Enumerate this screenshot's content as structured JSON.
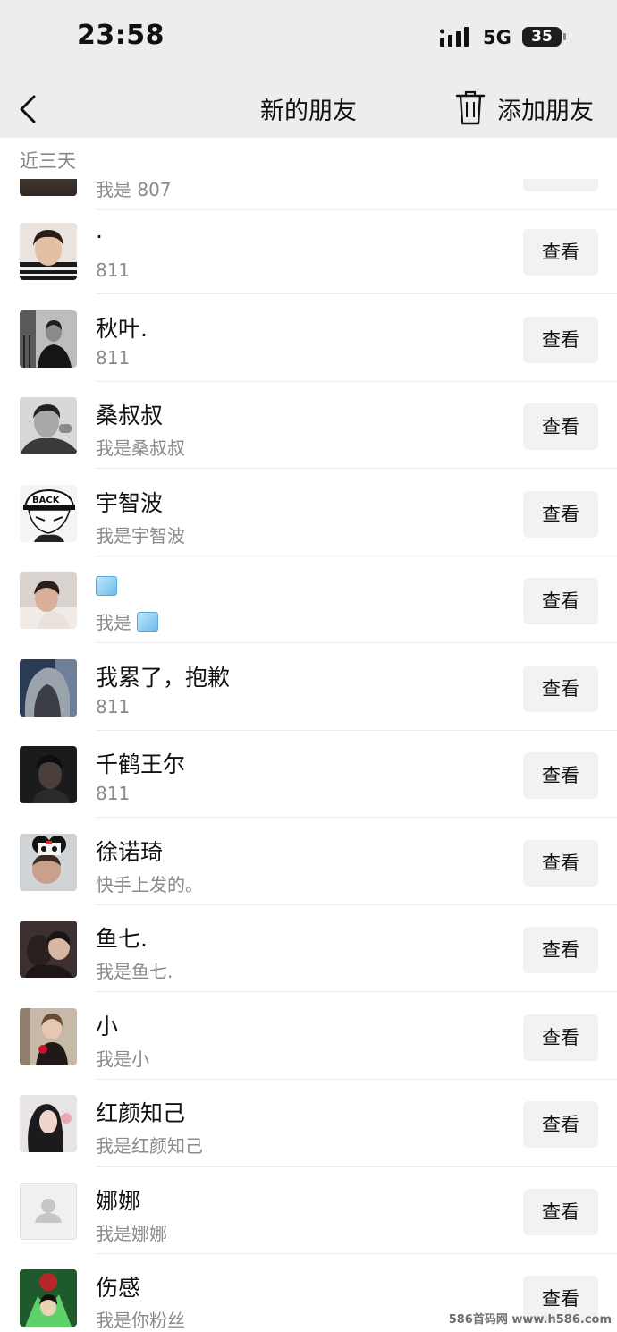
{
  "status_bar": {
    "time": "23:58",
    "network": "5G",
    "battery": "35"
  },
  "nav": {
    "title": "新的朋友",
    "add_friend_label": "添加朋友"
  },
  "section": {
    "label": "近三天"
  },
  "partial_row": {
    "message": "我是 807"
  },
  "view_label": "查看",
  "rows": [
    {
      "name": "·",
      "message": "811",
      "avatar": "portrait-boy-smiling",
      "has_ice_emoji": false
    },
    {
      "name": "秋叶.",
      "message": "811",
      "avatar": "portrait-man-suit-bw",
      "has_ice_emoji": false
    },
    {
      "name": "桑叔叔",
      "message": "我是桑叔叔",
      "avatar": "portrait-man-bw",
      "has_ice_emoji": false
    },
    {
      "name": "宇智波",
      "message": "我是宇智波",
      "avatar": "anime-cap-boy",
      "has_ice_emoji": false
    },
    {
      "name": "",
      "message": "我是",
      "avatar": "portrait-boy-lying",
      "has_ice_emoji": true
    },
    {
      "name": "我累了，抱歉",
      "message": "811",
      "avatar": "hooded-figure",
      "has_ice_emoji": false
    },
    {
      "name": "千鹤王尔",
      "message": "811",
      "avatar": "portrait-dark",
      "has_ice_emoji": false
    },
    {
      "name": "徐诺琦",
      "message": "快手上发的。",
      "avatar": "girl-panda-hat",
      "has_ice_emoji": false
    },
    {
      "name": "鱼七.",
      "message": "我是鱼七.",
      "avatar": "couple-dark",
      "has_ice_emoji": false
    },
    {
      "name": "小",
      "message": "我是小",
      "avatar": "portrait-rose",
      "has_ice_emoji": false
    },
    {
      "name": "红颜知己",
      "message": "我是红颜知己",
      "avatar": "girl-long-hair",
      "has_ice_emoji": false
    },
    {
      "name": "娜娜",
      "message": "我是娜娜",
      "avatar": "default-avatar",
      "has_ice_emoji": false
    },
    {
      "name": "伤感",
      "message": "我是你粉丝",
      "avatar": "anime-green",
      "has_ice_emoji": false
    }
  ],
  "watermark": "586首码网 www.h586.com"
}
